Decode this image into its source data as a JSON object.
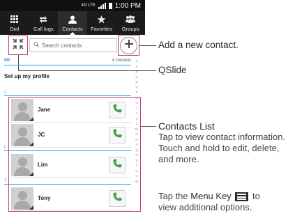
{
  "status_bar": {
    "network": "4G LTE",
    "time": "1:00 PM"
  },
  "tabs": [
    {
      "label": "Dial",
      "icon": "dialpad-icon",
      "active": false
    },
    {
      "label": "Call logs",
      "icon": "call-logs-icon",
      "active": false
    },
    {
      "label": "Contacts",
      "icon": "contact-person-icon",
      "active": true
    },
    {
      "label": "Favorites",
      "icon": "star-icon",
      "active": false
    },
    {
      "label": "Groups",
      "icon": "groups-icon",
      "active": false
    }
  ],
  "search": {
    "placeholder": "Search contacts"
  },
  "me_section": {
    "header": "ME",
    "count": "4 contacts",
    "profile_label": "Set up my profile"
  },
  "alphabet": [
    "#",
    "A",
    "B",
    "C",
    "D",
    "E",
    "F",
    "G",
    "H",
    "I",
    "J",
    "K",
    "L",
    "M",
    "N",
    "O",
    "P",
    "Q",
    "R",
    "S",
    "T",
    "U",
    "V",
    "W"
  ],
  "sections": [
    {
      "letter": "J",
      "contacts": [
        "Jane",
        "JC"
      ]
    },
    {
      "letter": "L",
      "contacts": [
        "Lim"
      ]
    },
    {
      "letter": "T",
      "contacts": [
        "Tony"
      ]
    }
  ],
  "annotations": {
    "add_contact": "Add a new contact.",
    "qslide": "QSlide",
    "contacts_list_title": "Contacts List",
    "contacts_list_body": "Tap to view contact information. Touch and hold to edit, delete, and more.",
    "menu_prefix": "Tap the ",
    "menu_key": "Menu Key",
    "menu_mid": " to",
    "menu_suffix": "view additional options."
  },
  "colors": {
    "highlight": "#c13a87",
    "accent": "#3a9bd9",
    "call_green": "#3fa34d"
  }
}
